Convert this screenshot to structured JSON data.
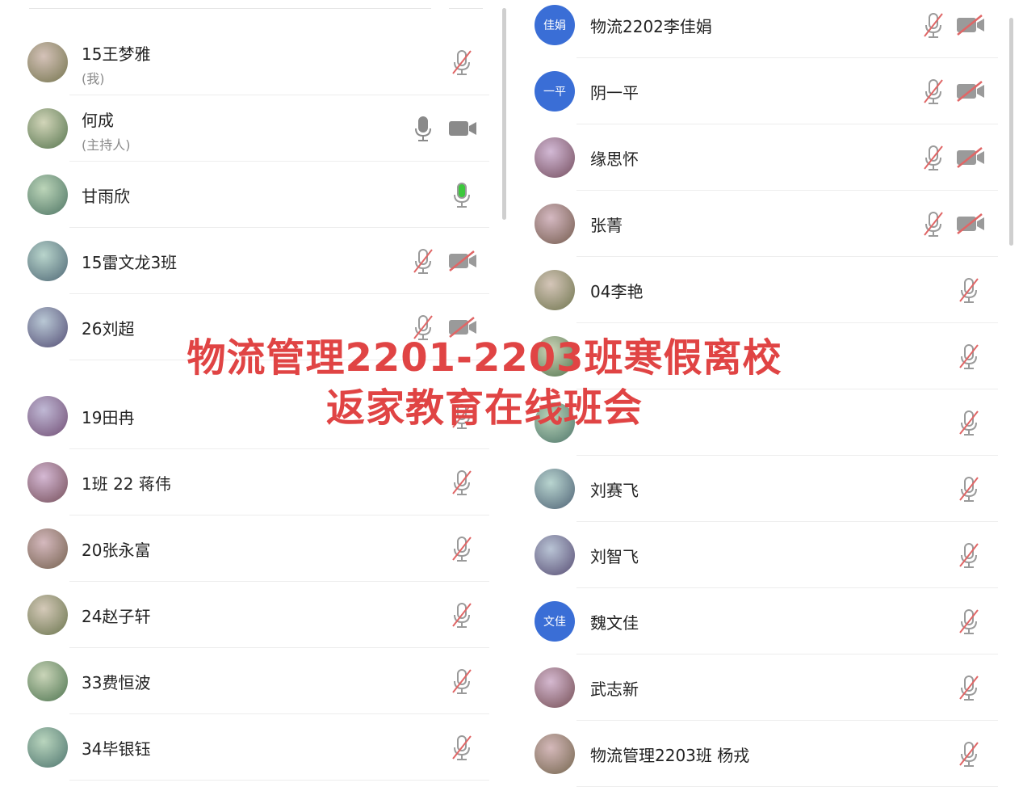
{
  "overlay_title": {
    "line1": "物流管理2201-2203班寒假离校",
    "line2": "返家教育在线班会"
  },
  "colors": {
    "accent_avatar": "#3a6ed6",
    "overlay_text": "#e04444",
    "muted_icon": "#9a9a9a",
    "slash_red": "#e06666",
    "speaking_green": "#3cc83c"
  },
  "left_participants": [
    {
      "name": "15王梦雅",
      "role": "(我)",
      "avatar_icon": "user-photo",
      "audio": "muted",
      "video": "none"
    },
    {
      "name": "何成",
      "role": "(主持人)",
      "avatar_icon": "user-photo",
      "audio": "on",
      "video": "on"
    },
    {
      "name": "甘雨欣",
      "avatar_icon": "user-photo",
      "audio": "speaking",
      "video": "none"
    },
    {
      "name": "15雷文龙3班",
      "avatar_icon": "user-photo",
      "audio": "muted",
      "video": "off"
    },
    {
      "name": "26刘超",
      "avatar_icon": "user-photo",
      "audio": "muted",
      "video": "off"
    },
    {
      "name": "19田冉",
      "avatar_icon": "user-photo",
      "audio": "muted",
      "video": "none"
    },
    {
      "name": "1班 22 蒋伟",
      "avatar_icon": "user-photo",
      "audio": "muted",
      "video": "none"
    },
    {
      "name": "20张永富",
      "avatar_icon": "user-photo",
      "audio": "muted",
      "video": "none"
    },
    {
      "name": "24赵子轩",
      "avatar_icon": "user-photo",
      "audio": "muted",
      "video": "none"
    },
    {
      "name": "33费恒波",
      "avatar_icon": "user-photo",
      "audio": "muted",
      "video": "none"
    },
    {
      "name": "34毕银钰",
      "avatar_icon": "user-photo",
      "audio": "muted",
      "video": "none"
    }
  ],
  "right_participants": [
    {
      "name": "物流2202李佳娟",
      "avatar_text": "佳娟",
      "audio": "muted",
      "video": "off"
    },
    {
      "name": "阴一平",
      "avatar_text": "一平",
      "audio": "muted",
      "video": "off"
    },
    {
      "name": "缘思怀",
      "avatar_icon": "user-photo",
      "audio": "muted",
      "video": "off"
    },
    {
      "name": "张菁",
      "avatar_icon": "user-photo",
      "audio": "muted",
      "video": "off"
    },
    {
      "name": "04李艳",
      "avatar_icon": "user-photo",
      "audio": "muted",
      "video": "none"
    },
    {
      "name": "",
      "avatar_icon": "user-photo",
      "audio": "muted",
      "video": "none"
    },
    {
      "name": "",
      "avatar_icon": "user-photo",
      "audio": "muted",
      "video": "none"
    },
    {
      "name": "刘赛飞",
      "avatar_icon": "user-photo",
      "audio": "muted",
      "video": "none"
    },
    {
      "name": "刘智飞",
      "avatar_icon": "user-photo",
      "audio": "muted",
      "video": "none"
    },
    {
      "name": "魏文佳",
      "avatar_text": "文佳",
      "audio": "muted",
      "video": "none"
    },
    {
      "name": "武志新",
      "avatar_icon": "user-photo",
      "audio": "muted",
      "video": "none"
    },
    {
      "name": "物流管理2203班 杨戎",
      "avatar_icon": "user-photo",
      "audio": "muted",
      "video": "none"
    }
  ]
}
